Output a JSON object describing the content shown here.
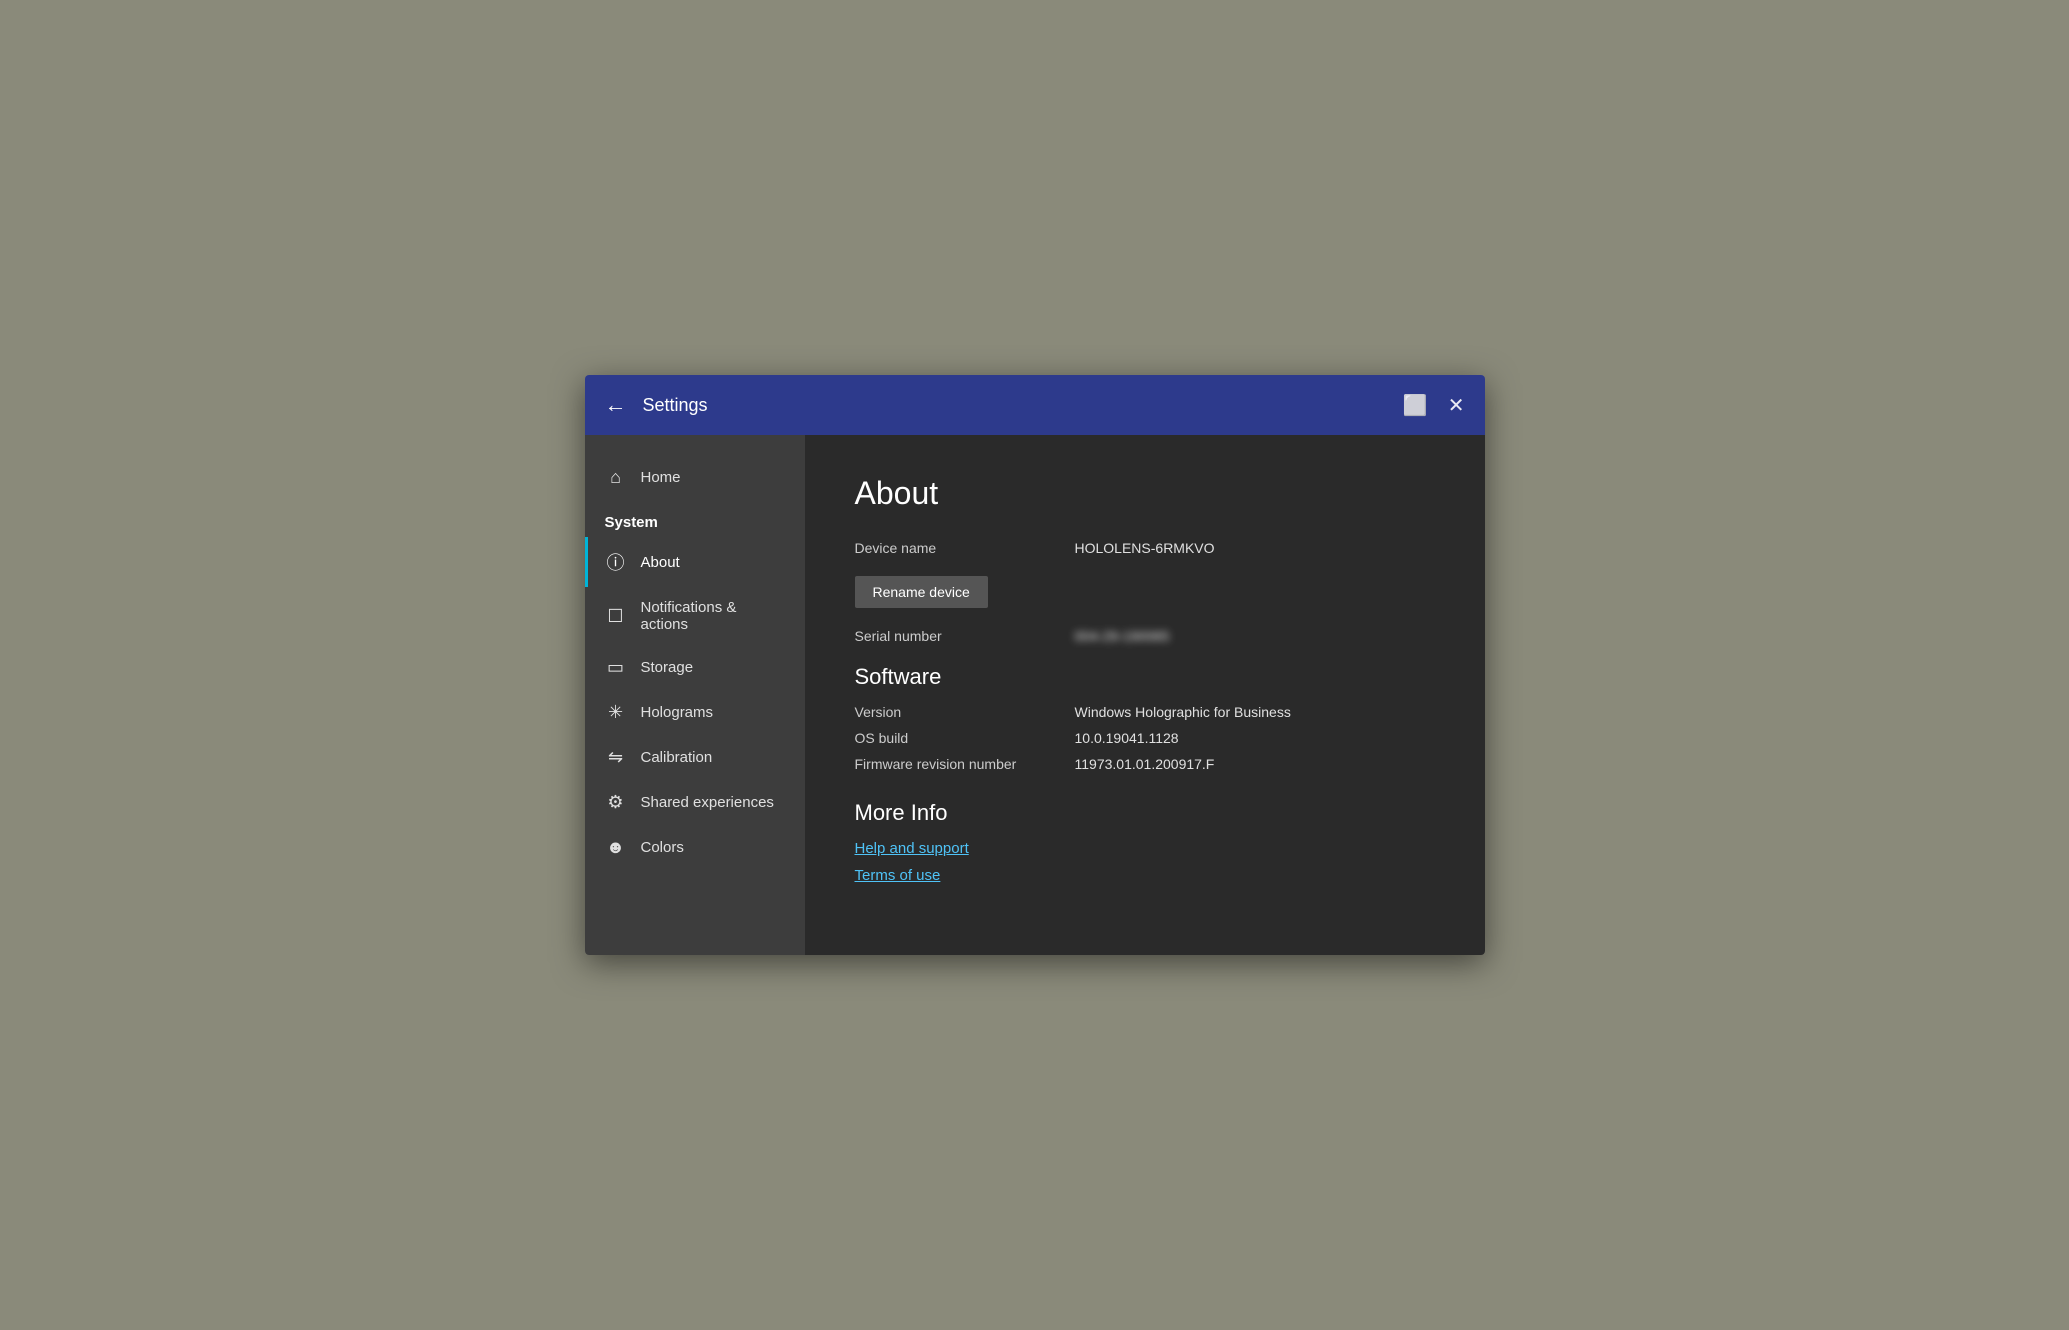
{
  "titlebar": {
    "title": "Settings",
    "back_label": "←",
    "window_icon": "⬜",
    "close_icon": "✕"
  },
  "sidebar": {
    "home_label": "Home",
    "section_label": "System",
    "items": [
      {
        "id": "about",
        "label": "About",
        "icon": "ℹ",
        "active": true
      },
      {
        "id": "notifications",
        "label": "Notifications & actions",
        "icon": "🖳",
        "active": false
      },
      {
        "id": "storage",
        "label": "Storage",
        "icon": "⊟",
        "active": false
      },
      {
        "id": "holograms",
        "label": "Holograms",
        "icon": "✦",
        "active": false
      },
      {
        "id": "calibration",
        "label": "Calibration",
        "icon": "⇌",
        "active": false
      },
      {
        "id": "shared",
        "label": "Shared experiences",
        "icon": "⚙",
        "active": false
      },
      {
        "id": "colors",
        "label": "Colors",
        "icon": "☺",
        "active": false
      }
    ]
  },
  "content": {
    "page_title": "About",
    "device_name_label": "Device name",
    "device_name_value": "HOLOLENS-6RMKVO",
    "rename_btn_label": "Rename device",
    "serial_number_label": "Serial number",
    "serial_number_value": "004-29-190065",
    "software_heading": "Software",
    "version_label": "Version",
    "version_value": "Windows Holographic for Business",
    "os_build_label": "OS build",
    "os_build_value": "10.0.19041.1128",
    "firmware_label": "Firmware revision number",
    "firmware_value": "11973.01.01.200917.F",
    "more_info_heading": "More Info",
    "help_link": "Help and support",
    "terms_link": "Terms of use"
  }
}
